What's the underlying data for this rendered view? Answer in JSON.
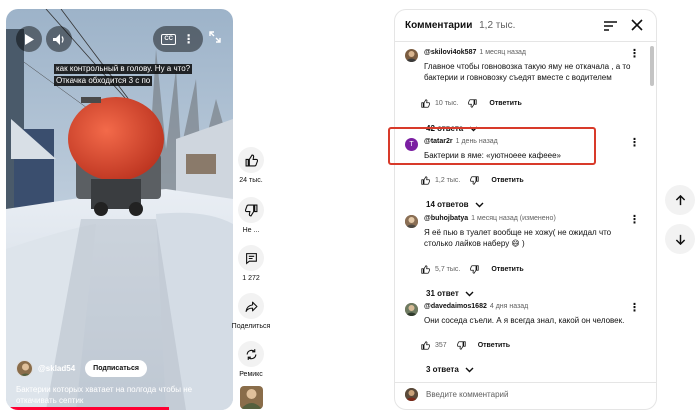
{
  "video": {
    "caption_line1": "как контрольный в голову. Ну а что?",
    "caption_line2": "Откачка обходится 3 с по",
    "channel": "@sklad54",
    "subscribe_label": "Подписаться",
    "title": "Бактерии которых хватает на полгода чтобы не откачивать септик",
    "progress": 0.72
  },
  "rail": {
    "like_count": "24 тыс.",
    "dislike_label": "Не ...",
    "comment_count": "1 272",
    "share_label": "Поделиться",
    "remix_label": "Ремикс"
  },
  "comments_panel": {
    "title": "Комментарии",
    "count": "1,2 тыс.",
    "input_placeholder": "Введите комментарий",
    "comments": [
      {
        "author": "@skilovi4ok587",
        "time": "1 месяц назад",
        "text": "Главное чтобы говновозка такую яму не откачала , а то бактерии и говновозку съедят вместе с водителем",
        "likes": "10 тыс.",
        "reply_label": "Ответить",
        "replies": "42 ответа"
      },
      {
        "author": "@tatar2r",
        "avatar_letter": "T",
        "time": "1 день назад",
        "text": "Бактерии в яме: «уютноеее кафеее»",
        "likes": "1,2 тыс.",
        "reply_label": "Ответить",
        "replies": "14 ответов"
      },
      {
        "author": "@buhojbatya",
        "time": "1 месяц назад (изменено)",
        "text": "Я её пью  в туалет вообще не хожу( не ожидал что столько лайков наберу 😄 )",
        "likes": "5,7 тыс.",
        "reply_label": "Ответить",
        "replies": "31 ответ"
      },
      {
        "author": "@davedaimos1682",
        "time": "4 дня назад",
        "text": "Они соседа съели. А я всегда знал, какой он человек.",
        "likes": "357",
        "reply_label": "Ответить",
        "replies": "3 ответа"
      }
    ]
  },
  "colors": {
    "highlight": "#d83a2a",
    "progress": "#ff0033",
    "reply_accent": "#0f0f0f"
  }
}
